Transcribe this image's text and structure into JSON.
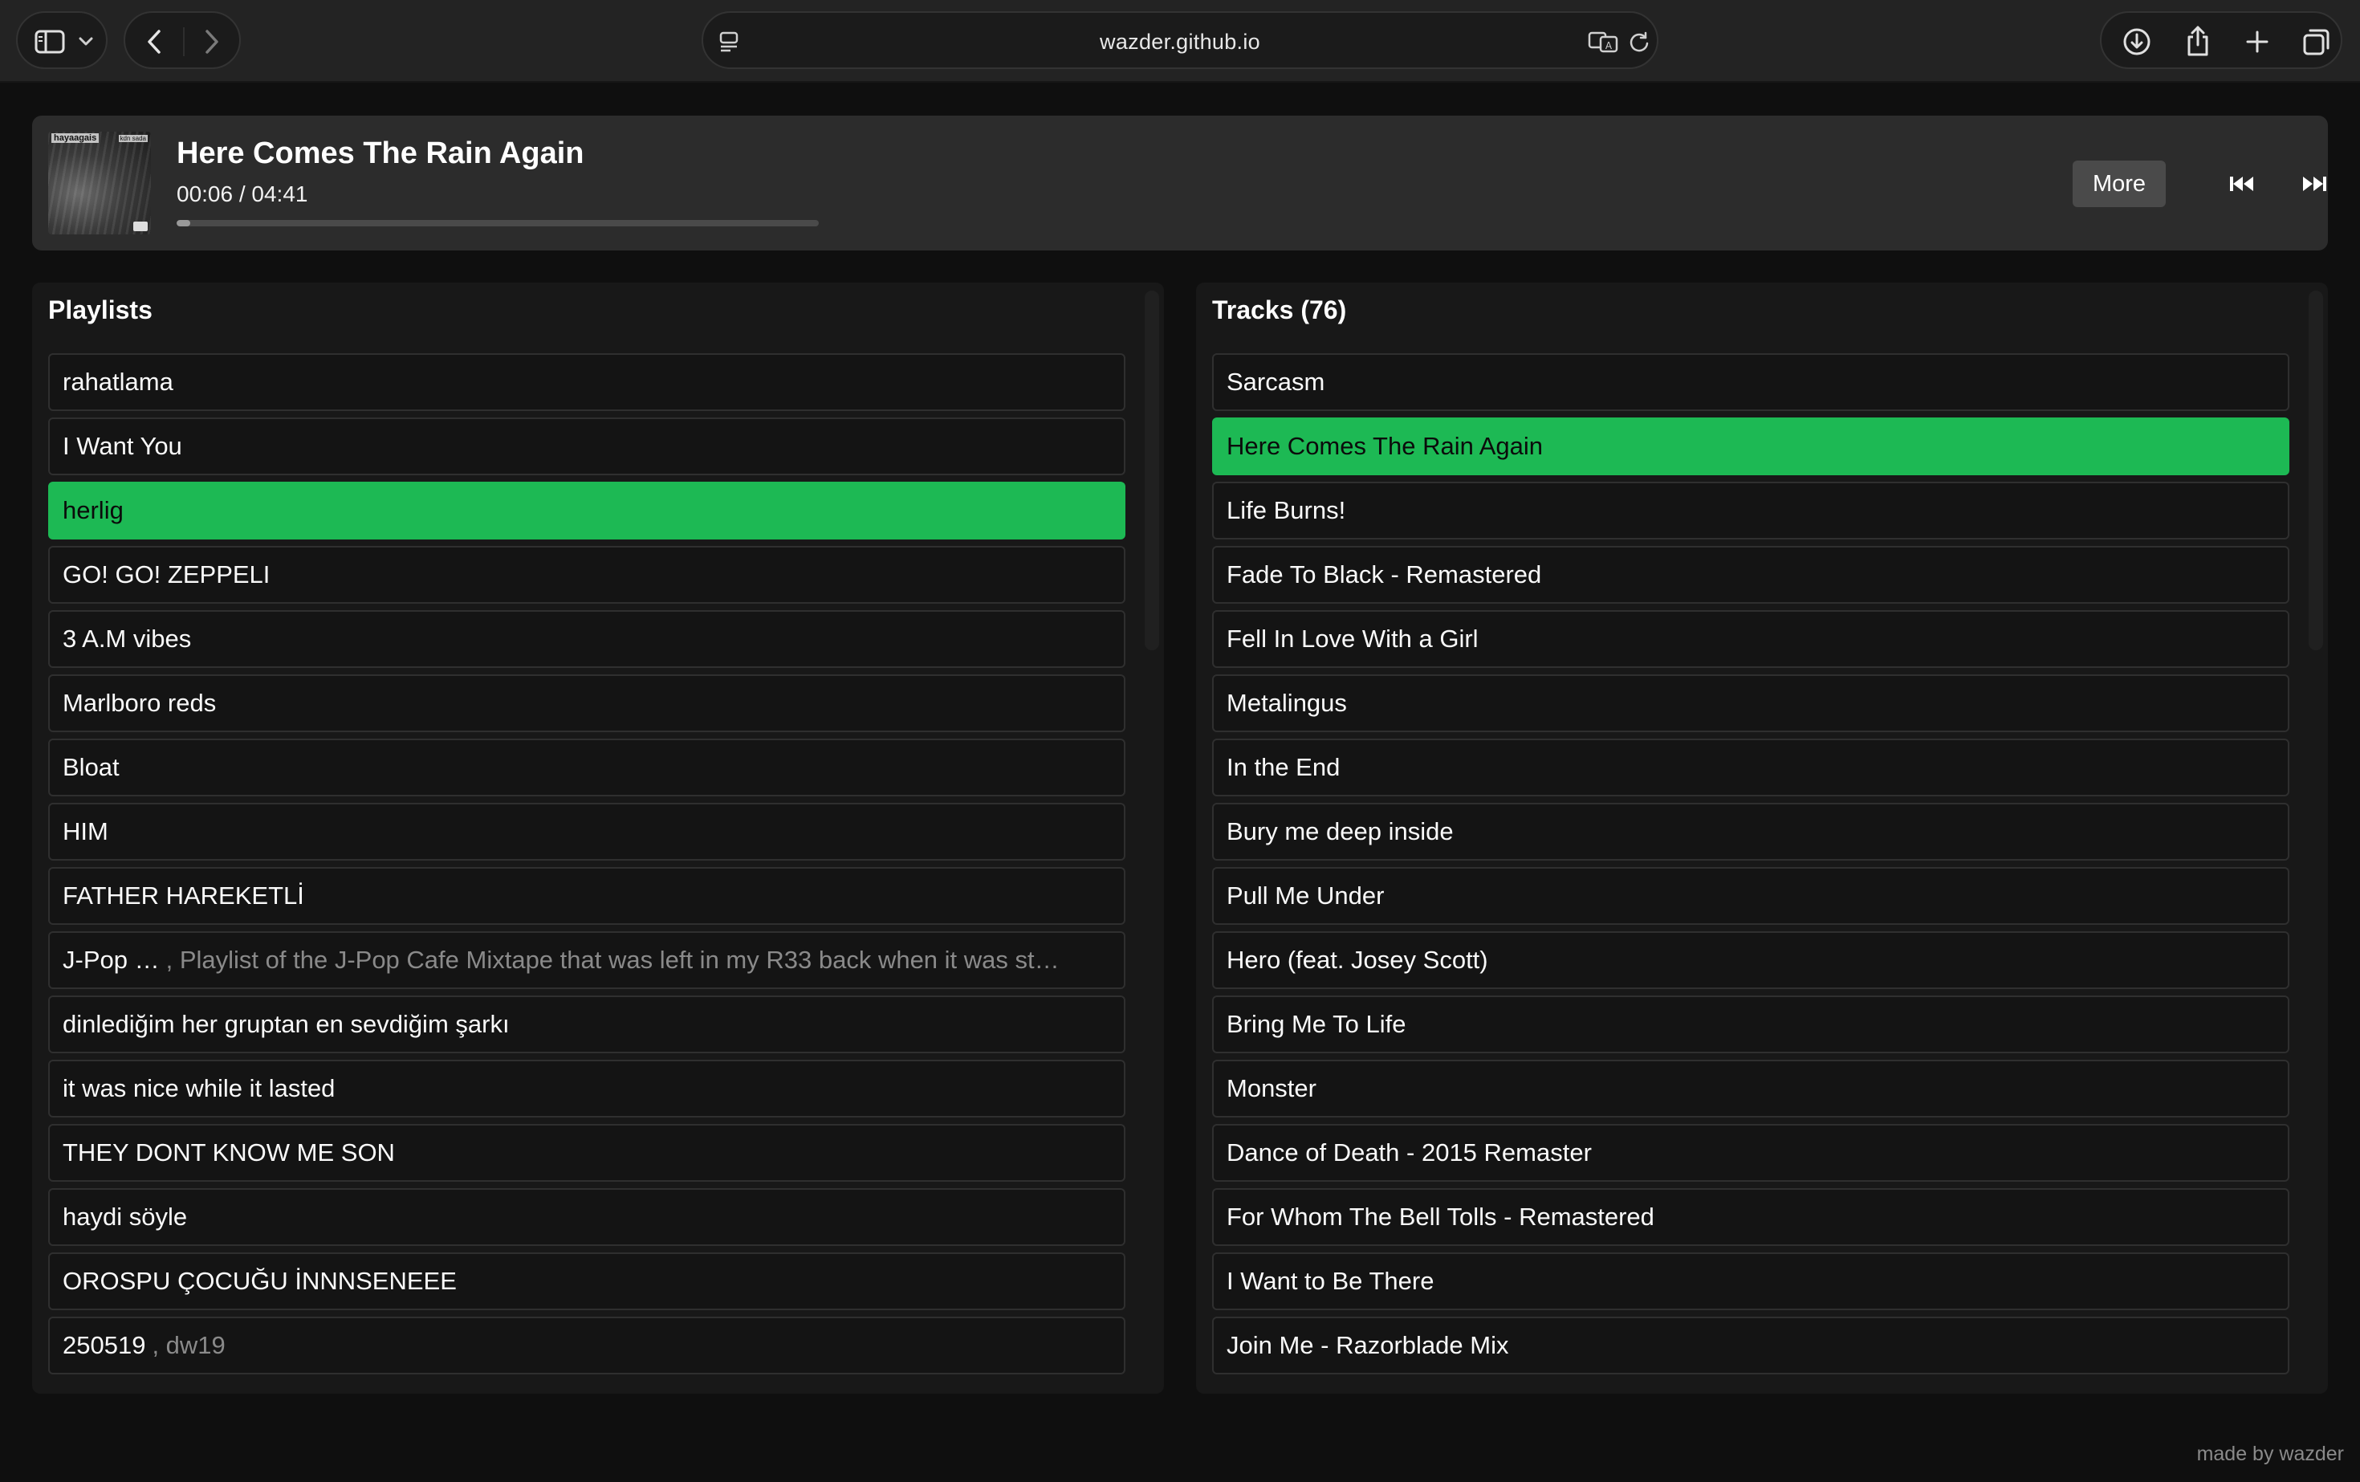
{
  "browser": {
    "url": "wazder.github.io"
  },
  "player": {
    "title": "Here Comes The Rain Again",
    "time": "00:06 / 04:41",
    "progress": 0.021,
    "more_label": "More",
    "cover": {
      "text_left": "hayaagais",
      "text_right": "kdn sada"
    }
  },
  "playlists": {
    "title": "Playlists",
    "items": [
      {
        "name": "rahatlama",
        "desc": ""
      },
      {
        "name": "I Want You",
        "desc": ""
      },
      {
        "name": "herlig",
        "desc": "",
        "active": true
      },
      {
        "name": "GO! GO! ZEPPELI",
        "desc": ""
      },
      {
        "name": "3 A.M vibes",
        "desc": ""
      },
      {
        "name": "Marlboro reds",
        "desc": ""
      },
      {
        "name": "Bloat",
        "desc": ""
      },
      {
        "name": "HIM",
        "desc": ""
      },
      {
        "name": "FATHER HAREKETLİ",
        "desc": ""
      },
      {
        "name": "J-Pop …",
        "desc": ", Playlist of the J-Pop Cafe Mixtape that was left in my R33 back when it was st…"
      },
      {
        "name": "dinlediğim her gruptan en sevdiğim şarkı",
        "desc": ""
      },
      {
        "name": "it was nice while it lasted",
        "desc": ""
      },
      {
        "name": "THEY DONT KNOW ME SON",
        "desc": ""
      },
      {
        "name": "haydi söyle",
        "desc": ""
      },
      {
        "name": "OROSPU ÇOCUĞU İNNNSENEEE",
        "desc": ""
      },
      {
        "name": "250519",
        "desc": ", dw19"
      }
    ]
  },
  "tracks": {
    "title": "Tracks (76)",
    "items": [
      {
        "name": "Sarcasm"
      },
      {
        "name": "Here Comes The Rain Again",
        "active": true
      },
      {
        "name": "Life Burns!"
      },
      {
        "name": "Fade To Black - Remastered"
      },
      {
        "name": "Fell In Love With a Girl"
      },
      {
        "name": "Metalingus"
      },
      {
        "name": "In the End"
      },
      {
        "name": "Bury me deep inside"
      },
      {
        "name": "Pull Me Under"
      },
      {
        "name": "Hero (feat. Josey Scott)"
      },
      {
        "name": "Bring Me To Life"
      },
      {
        "name": "Monster"
      },
      {
        "name": "Dance of Death - 2015 Remaster"
      },
      {
        "name": "For Whom The Bell Tolls - Remastered"
      },
      {
        "name": "I Want to Be There"
      },
      {
        "name": "Join Me - Razorblade Mix"
      }
    ]
  },
  "footer": {
    "credit": "made by wazder"
  },
  "colors": {
    "accent": "#1db954",
    "background": "#0f0f0f",
    "panel": "#181818",
    "player": "#2c2c2c"
  },
  "icons": [
    "sidebar-icon",
    "chevron-down-icon",
    "back-icon",
    "forward-icon",
    "reader-icon",
    "translate-icon",
    "reload-icon",
    "download-icon",
    "share-icon",
    "new-tab-icon",
    "tabs-overview-icon",
    "previous-track-icon",
    "next-track-icon"
  ]
}
